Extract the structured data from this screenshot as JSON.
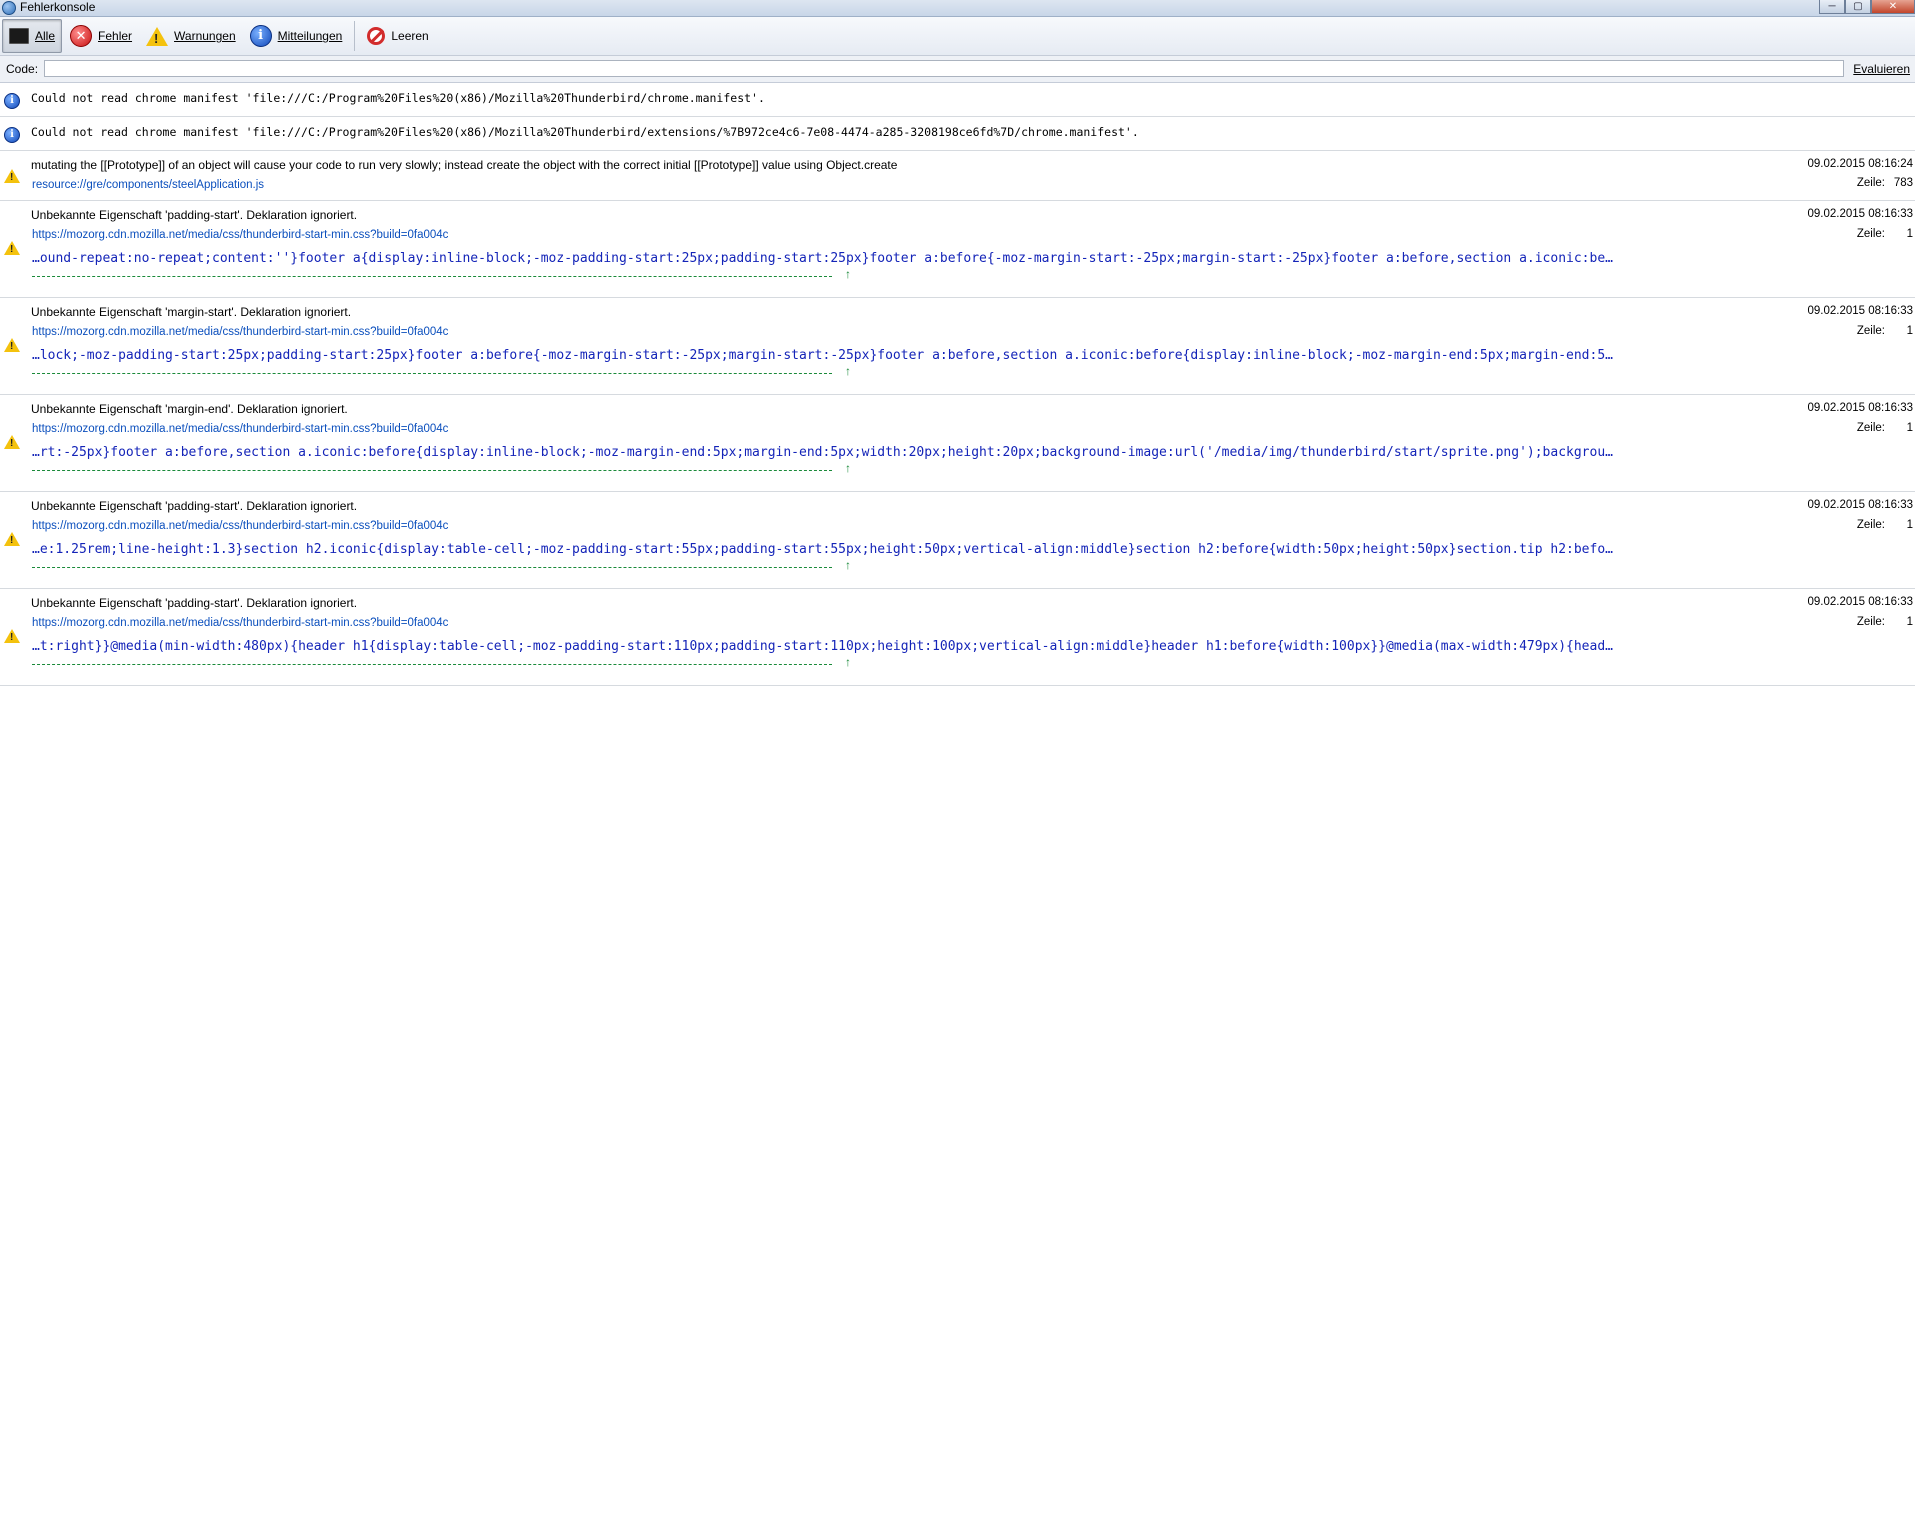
{
  "window": {
    "title": "Fehlerkonsole",
    "buttons": {
      "minimize": "─",
      "maximize": "▢",
      "close": "✕"
    }
  },
  "toolbar": {
    "all_label": "Alle",
    "errors_label": "Fehler",
    "warnings_label": "Warnungen",
    "messages_label": "Mitteilungen",
    "clear_label": "Leeren",
    "selected": "Alle"
  },
  "codebar": {
    "label": "Code:",
    "value": "",
    "evaluate_label": "Evaluieren"
  },
  "messages": [
    {
      "type": "info",
      "text": "Could not read chrome manifest 'file:///C:/Program%20Files%20(x86)/Mozilla%20Thunderbird/chrome.manifest'."
    },
    {
      "type": "info",
      "text": "Could not read chrome manifest 'file:///C:/Program%20Files%20(x86)/Mozilla%20Thunderbird/extensions/%7B972ce4c6-7e08-4474-a285-3208198ce6fd%7D/chrome.manifest'."
    },
    {
      "type": "warning",
      "text": "mutating the [[Prototype]] of an object will cause your code to run very slowly; instead create the object with the correct initial [[Prototype]] value using Object.create",
      "source": "resource://gre/components/steelApplication.js",
      "timestamp": "09.02.2015 08:16:24",
      "line_label": "Zeile:",
      "line": "783"
    },
    {
      "type": "warning",
      "text": "Unbekannte Eigenschaft 'padding-start'.  Deklaration ignoriert.",
      "source": "https://mozorg.cdn.mozilla.net/media/css/thunderbird-start-min.css?build=0fa004c",
      "code": "…ound-repeat:no-repeat;content:''}footer a{display:inline-block;-moz-padding-start:25px;padding-start:25px}footer a:before{-moz-margin-start:-25px;margin-start:-25px}footer a:before,section a.iconic:be…",
      "caret": "↑",
      "timestamp": "09.02.2015 08:16:33",
      "line_label": "Zeile:",
      "line": "1"
    },
    {
      "type": "warning",
      "text": "Unbekannte Eigenschaft 'margin-start'.  Deklaration ignoriert.",
      "source": "https://mozorg.cdn.mozilla.net/media/css/thunderbird-start-min.css?build=0fa004c",
      "code": "…lock;-moz-padding-start:25px;padding-start:25px}footer a:before{-moz-margin-start:-25px;margin-start:-25px}footer a:before,section a.iconic:before{display:inline-block;-moz-margin-end:5px;margin-end:5…",
      "caret": "↑",
      "timestamp": "09.02.2015 08:16:33",
      "line_label": "Zeile:",
      "line": "1"
    },
    {
      "type": "warning",
      "text": "Unbekannte Eigenschaft 'margin-end'.  Deklaration ignoriert.",
      "source": "https://mozorg.cdn.mozilla.net/media/css/thunderbird-start-min.css?build=0fa004c",
      "code": "…rt:-25px}footer a:before,section a.iconic:before{display:inline-block;-moz-margin-end:5px;margin-end:5px;width:20px;height:20px;background-image:url('/media/img/thunderbird/start/sprite.png');backgrou…",
      "caret": "↑",
      "timestamp": "09.02.2015 08:16:33",
      "line_label": "Zeile:",
      "line": "1"
    },
    {
      "type": "warning",
      "text": "Unbekannte Eigenschaft 'padding-start'.  Deklaration ignoriert.",
      "source": "https://mozorg.cdn.mozilla.net/media/css/thunderbird-start-min.css?build=0fa004c",
      "code": "…e:1.25rem;line-height:1.3}section h2.iconic{display:table-cell;-moz-padding-start:55px;padding-start:55px;height:50px;vertical-align:middle}section h2:before{width:50px;height:50px}section.tip h2:befo…",
      "caret": "↑",
      "timestamp": "09.02.2015 08:16:33",
      "line_label": "Zeile:",
      "line": "1"
    },
    {
      "type": "warning",
      "text": "Unbekannte Eigenschaft 'padding-start'.  Deklaration ignoriert.",
      "source": "https://mozorg.cdn.mozilla.net/media/css/thunderbird-start-min.css?build=0fa004c",
      "code": "…t:right}}@media(min-width:480px){header h1{display:table-cell;-moz-padding-start:110px;padding-start:110px;height:100px;vertical-align:middle}header h1:before{width:100px}}@media(max-width:479px){head…",
      "caret": "↑",
      "timestamp": "09.02.2015 08:16:33",
      "line_label": "Zeile:",
      "line": "1"
    }
  ]
}
